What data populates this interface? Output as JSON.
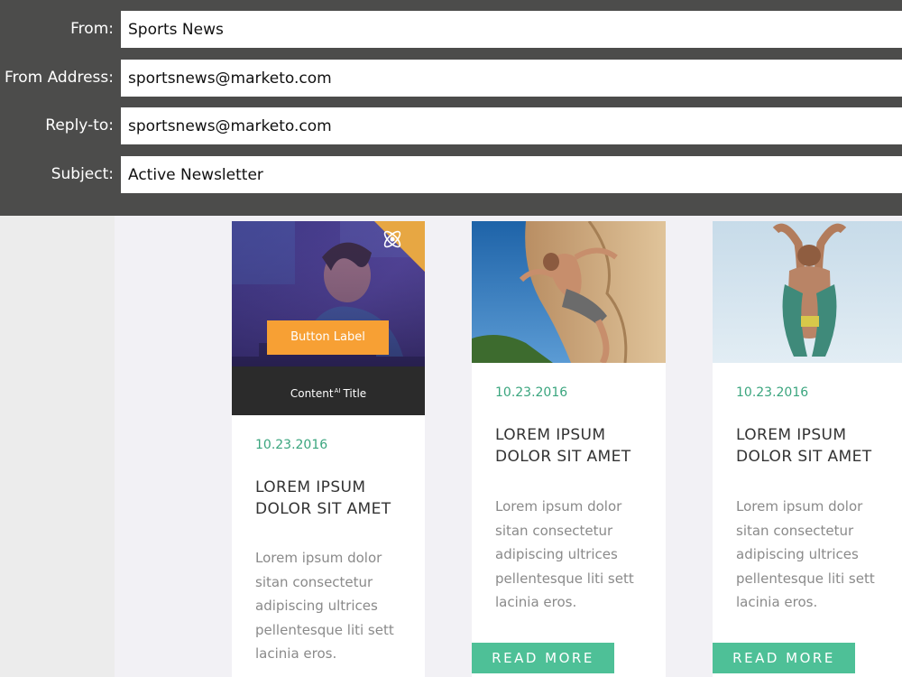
{
  "header": {
    "fields": [
      {
        "label": "From:",
        "value": "Sports News"
      },
      {
        "label": "From Address:",
        "value": "sportsnews@marketo.com"
      },
      {
        "label": "Reply-to:",
        "value": "sportsnews@marketo.com"
      },
      {
        "label": "Subject:",
        "value": "Active Newsletter"
      }
    ]
  },
  "dynamic_content": {
    "button_label": "Button Label",
    "title_prefix": "Content",
    "title_superscript": "AI",
    "title_suffix": "Title",
    "badge_icon": "atom-icon"
  },
  "cards": [
    {
      "image_icon": "person-laptop-photo",
      "date": "10.23.2016",
      "title": "LOREM IPSUM DOLOR SIT AMET",
      "text": "Lorem ipsum dolor sitan consectetur adipiscing ultrices pellentesque liti sett lacinia eros."
    },
    {
      "image_icon": "rock-climber-photo",
      "date": "10.23.2016",
      "title": "LOREM IPSUM DOLOR SIT AMET",
      "text": "Lorem ipsum dolor sitan consectetur adipiscing ultrices pellentesque liti sett lacinia eros.",
      "button_label": "READ MORE"
    },
    {
      "image_icon": "diver-photo",
      "date": "10.23.2016",
      "title": "LOREM IPSUM DOLOR SIT AMET",
      "text": "Lorem ipsum dolor sitan consectetur adipiscing ultrices pellentesque liti sett lacinia eros.",
      "button_label": "READ MORE"
    }
  ],
  "colors": {
    "header_bg": "#4c4c4b",
    "accent_green": "#4ec097",
    "date_green": "#3aa57e",
    "dynamic_button_orange": "#f7a034"
  }
}
